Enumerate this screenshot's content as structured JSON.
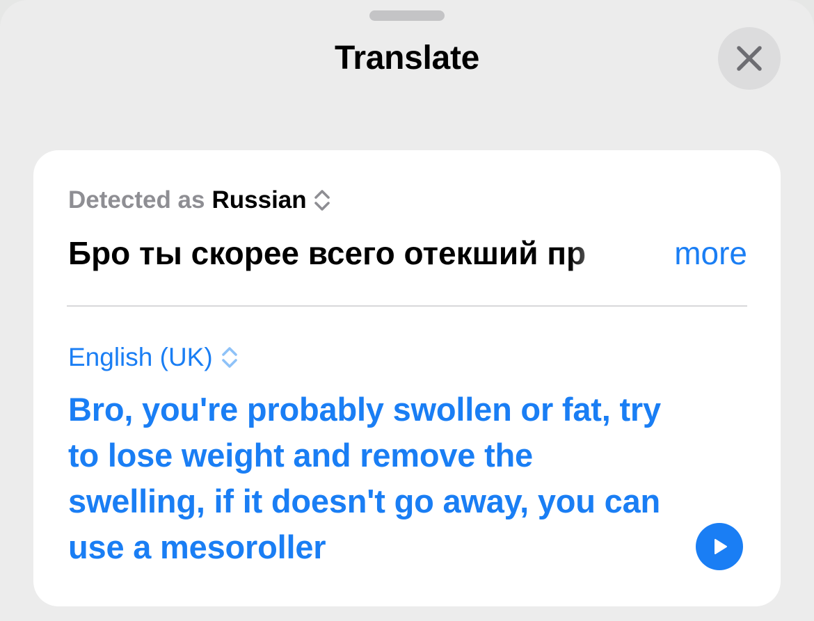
{
  "header": {
    "title": "Translate",
    "close_icon": "close-icon"
  },
  "source": {
    "detected_prefix": "Detected as",
    "language": "Russian",
    "selector_icon": "chevron-up-down-icon",
    "text": "Бро ты скорее всего отекший пр",
    "more_label": "more"
  },
  "target": {
    "language": "English (UK)",
    "selector_icon": "chevron-up-down-icon",
    "text": "Bro, you're probably swollen or fat, try to lose weight and remove the swelling, if it doesn't go away, you can use a mesoroller",
    "play_icon": "play-icon"
  },
  "colors": {
    "accent": "#1a7ef4",
    "secondary_text": "#8e8e93",
    "sheet_background": "#ececec",
    "card_background": "#ffffff"
  }
}
